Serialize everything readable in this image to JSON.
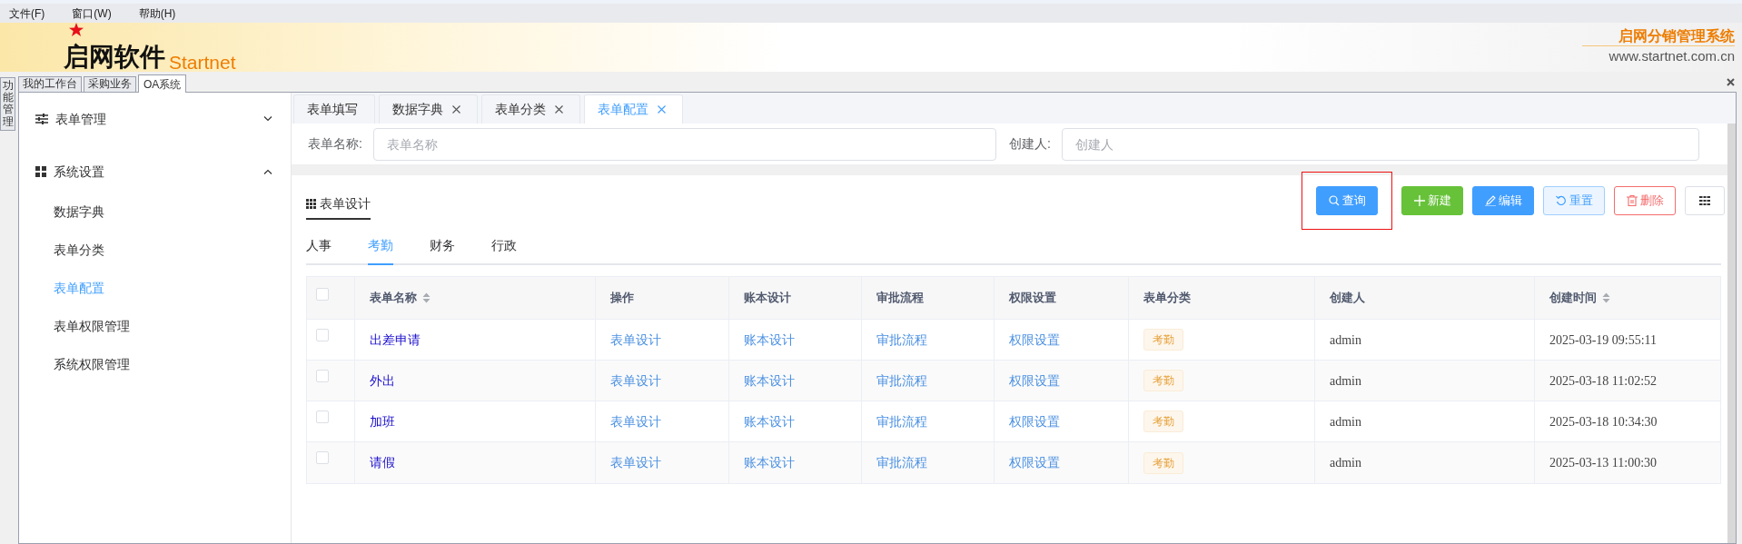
{
  "menu_bar": [
    "文件(F)",
    "窗口(W)",
    "帮助(H)"
  ],
  "header": {
    "logo_text": "启网软件",
    "logo_latin": "Startnet",
    "system_name": "启网分销管理系统",
    "website": "www.startnet.com.cn"
  },
  "side_tab": "功能管理",
  "app_tabs": [
    {
      "label": "我的工作台",
      "selected": false
    },
    {
      "label": "采购业务",
      "selected": false
    },
    {
      "label": "OA系统",
      "selected": true
    }
  ],
  "sidebar": {
    "groups": [
      {
        "label": "表单管理",
        "kind": "sliders",
        "expanded": false
      },
      {
        "label": "系统设置",
        "kind": "grid",
        "expanded": true,
        "children": [
          {
            "label": "数据字典",
            "selected": false
          },
          {
            "label": "表单分类",
            "selected": false
          },
          {
            "label": "表单配置",
            "selected": true
          },
          {
            "label": "表单权限管理",
            "selected": false
          },
          {
            "label": "系统权限管理",
            "selected": false
          }
        ]
      }
    ]
  },
  "page_tabs": [
    {
      "label": "表单填写",
      "closable": false,
      "selected": false
    },
    {
      "label": "数据字典",
      "closable": true,
      "selected": false
    },
    {
      "label": "表单分类",
      "closable": true,
      "selected": false
    },
    {
      "label": "表单配置",
      "closable": true,
      "selected": true
    }
  ],
  "filters": [
    {
      "label": "表单名称:",
      "placeholder": "表单名称"
    },
    {
      "label": "创建人:",
      "placeholder": "创建人"
    }
  ],
  "card": {
    "title": "表单设计",
    "buttons": [
      {
        "kind": "query",
        "label": "查询",
        "highlighted": true
      },
      {
        "kind": "create",
        "label": "新建",
        "highlighted": false
      },
      {
        "kind": "edit",
        "label": "编辑",
        "highlighted": false
      },
      {
        "kind": "reset",
        "label": "重置",
        "highlighted": false
      },
      {
        "kind": "delete",
        "label": "删除",
        "highlighted": false
      },
      {
        "kind": "columns",
        "highlighted": false
      }
    ],
    "category_tabs": [
      {
        "label": "人事",
        "selected": false
      },
      {
        "label": "考勤",
        "selected": true
      },
      {
        "label": "财务",
        "selected": false
      },
      {
        "label": "行政",
        "selected": false
      }
    ],
    "table": {
      "all_checked": false,
      "columns": [
        {
          "label": "表单名称",
          "sortable": true
        },
        {
          "label": "操作",
          "sortable": false
        },
        {
          "label": "账本设计",
          "sortable": false
        },
        {
          "label": "审批流程",
          "sortable": false
        },
        {
          "label": "权限设置",
          "sortable": false
        },
        {
          "label": "表单分类",
          "sortable": false
        },
        {
          "label": "创建人",
          "sortable": false
        },
        {
          "label": "创建时间",
          "sortable": true
        }
      ],
      "rows": [
        {
          "checked": false,
          "name": "出差申请",
          "operation": "表单设计",
          "ledger": "账本设计",
          "approval": "审批流程",
          "permission": "权限设置",
          "category": "考勤",
          "creator": "admin",
          "created": "2025-03-19 09:55:11"
        },
        {
          "checked": false,
          "name": "外出",
          "operation": "表单设计",
          "ledger": "账本设计",
          "approval": "审批流程",
          "permission": "权限设置",
          "category": "考勤",
          "creator": "admin",
          "created": "2025-03-18 11:02:52"
        },
        {
          "checked": false,
          "name": "加班",
          "operation": "表单设计",
          "ledger": "账本设计",
          "approval": "审批流程",
          "permission": "权限设置",
          "category": "考勤",
          "creator": "admin",
          "created": "2025-03-18 10:34:30"
        },
        {
          "checked": false,
          "name": "请假",
          "operation": "表单设计",
          "ledger": "账本设计",
          "approval": "审批流程",
          "permission": "权限设置",
          "category": "考勤",
          "creator": "admin",
          "created": "2025-03-13 11:00:30"
        }
      ]
    }
  }
}
